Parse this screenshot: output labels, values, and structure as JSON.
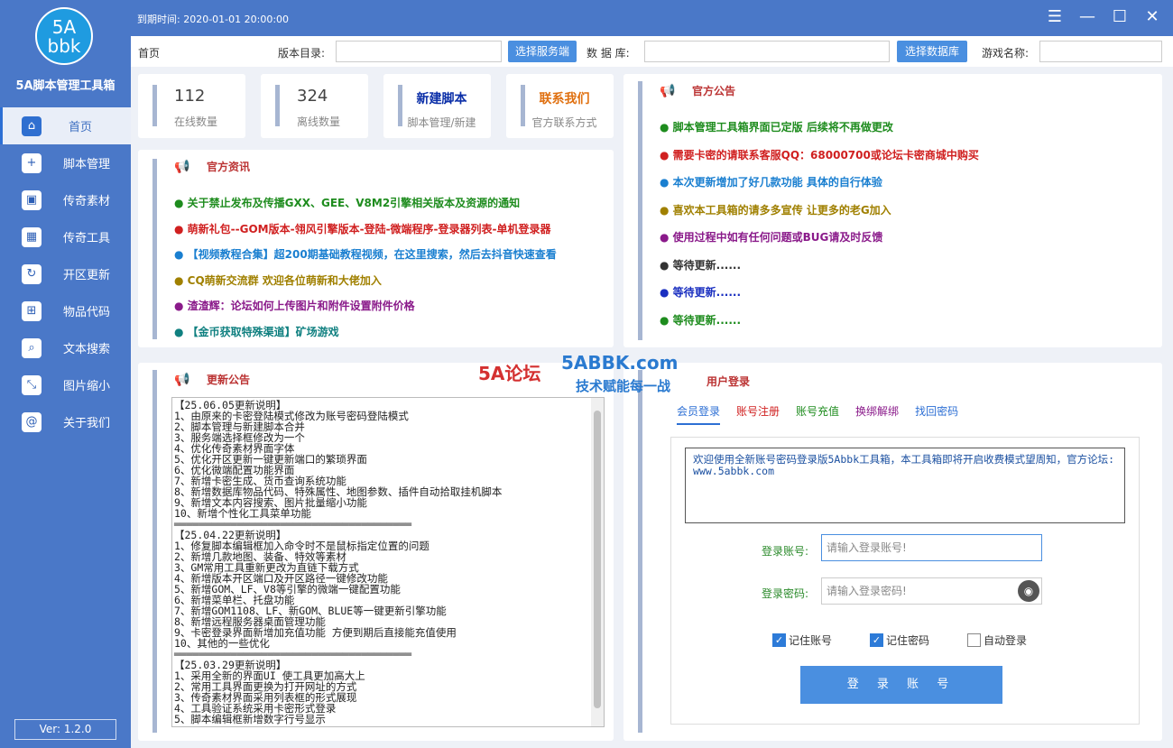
{
  "app": {
    "logo_line1": "5A",
    "logo_line2": "bbk",
    "title": "5A脚本管理工具箱",
    "version": "Ver: 1.2.0",
    "expire": "到期时间: 2020-01-01 20:00:00"
  },
  "nav": [
    {
      "label": "首页",
      "icon": "home-icon"
    },
    {
      "label": "脚本管理",
      "icon": "plus-box-icon"
    },
    {
      "label": "传奇素材",
      "icon": "image-icon"
    },
    {
      "label": "传奇工具",
      "icon": "grid-icon"
    },
    {
      "label": "开区更新",
      "icon": "refresh-icon"
    },
    {
      "label": "物品代码",
      "icon": "network-icon"
    },
    {
      "label": "文本搜索",
      "icon": "search-icon"
    },
    {
      "label": "图片缩小",
      "icon": "compress-icon"
    },
    {
      "label": "关于我们",
      "icon": "at-icon"
    }
  ],
  "toolbar": {
    "home": "首页",
    "version_dir_label": "版本目录:",
    "select_server": "选择服务端",
    "database_label": "数 据 库:",
    "select_database": "选择数据库",
    "game_name_label": "游戏名称:"
  },
  "stats": {
    "online_num": "112",
    "online_label": "在线数量",
    "offline_num": "324",
    "offline_label": "离线数量",
    "new_script": "新建脚本",
    "new_script_sub": "脚本管理/新建",
    "contact": "联系我们",
    "contact_sub": "官方联系方式"
  },
  "news": {
    "title": "官方资讯",
    "items": [
      {
        "text": "关于禁止发布及传播GXX、GEE、V8M2引擎相关版本及资源的通知",
        "color": "#1e8c1e"
      },
      {
        "text": "萌新礼包--GOM版本-翎风引擎版本-登陆-微端程序-登录器列表-单机登录器",
        "color": "#d02020"
      },
      {
        "text": "【视频教程合集】超200期基础教程视频，在这里搜索，然后去抖音快速查看",
        "color": "#1a7fd0"
      },
      {
        "text": "CQ萌新交流群 欢迎各位萌新和大佬加入",
        "color": "#a08000"
      },
      {
        "text": "渣渣辉：论坛如何上传图片和附件设置附件价格",
        "color": "#8a1a8a"
      },
      {
        "text": "【金币获取特殊渠道】矿场游戏",
        "color": "#108080"
      }
    ]
  },
  "announce": {
    "title": "官方公告",
    "items": [
      {
        "text": "脚本管理工具箱界面已定版 后续将不再做更改",
        "color": "#1e8c1e"
      },
      {
        "text": "需要卡密的请联系客服QQ：68000700或论坛卡密商城中购买",
        "color": "#d02020"
      },
      {
        "text": "本次更新增加了好几款功能 具体的自行体验",
        "color": "#1a7fd0"
      },
      {
        "text": "喜欢本工具箱的请多多宣传 让更多的老G加入",
        "color": "#a08000"
      },
      {
        "text": "使用过程中如有任何问题或BUG请及时反馈",
        "color": "#8a1a8a"
      },
      {
        "text": "等待更新......",
        "color": "#333333"
      },
      {
        "text": "等待更新......",
        "color": "#1a2fc0"
      },
      {
        "text": "等待更新......",
        "color": "#1e8c1e"
      }
    ]
  },
  "update": {
    "title": "更新公告",
    "text": "【25.06.05更新说明】\n1、由原来的卡密登陆模式修改为账号密码登陆模式\n2、脚本管理与新建脚本合并\n3、服务端选择框修改为一个\n4、优化传奇素材界面字体\n5、优化开区更新一键更新端口的繁琐界面\n6、优化微端配置功能界面\n7、新增卡密生成、货币查询系统功能\n8、新增数据库物品代码、特殊属性、地图参数、插件自动拾取挂机脚本\n9、新增文本内容搜索、图片批量缩小功能\n10、新增个性化工具菜单功能\n══════════════════════════════════════\n【25.04.22更新说明】\n1、修复脚本编辑框加入命令时不是鼠标指定位置的问题\n2、新增几款地图、装备、特效等素材\n3、GM常用工具重新更改为直链下载方式\n4、新增版本开区端口及开区路径一键修改功能\n5、新增GOM、LF、V8等引擎的微端一键配置功能\n6、新增菜单栏、托盘功能\n7、新增GOM1108、LF、新GOM、BLUE等一键更新引擎功能\n8、新增远程服务器桌面管理功能\n9、卡密登录界面新增加充值功能 方便到期后直接能充值使用\n10、其他的一些优化\n══════════════════════════════════════\n【25.03.29更新说明】\n1、采用全新的界面UI 使工具更加高大上\n2、常用工具界面更换为打开网址的方式\n3、传奇素材界面采用列表框的形式展现\n4、工具验证系统采用卡密形式登录\n5、脚本编辑框新增数字行号显示"
  },
  "login": {
    "title": "用户登录",
    "tabs": [
      "会员登录",
      "账号注册",
      "账号充值",
      "换绑解绑",
      "找回密码"
    ],
    "tab_colors": [
      "#2d6fd4",
      "#d02020",
      "#1e8c1e",
      "#8a1a8a",
      "#2d6fd4"
    ],
    "welcome": "欢迎使用全新账号密码登录版5Abbk工具箱，本工具箱即将开启收费模式望周知，官方论坛: www.5abbk.com",
    "account_label": "登录账号:",
    "account_placeholder": "请输入登录账号!",
    "password_label": "登录密码:",
    "password_placeholder": "请输入登录密码!",
    "remember_account": "记住账号",
    "remember_password": "记住密码",
    "auto_login": "自动登录",
    "login_button": "登 录 账 号"
  },
  "watermark": {
    "cn": "5A论坛",
    "en": "5ABBK.com",
    "slogan": "技术赋能每一战"
  }
}
